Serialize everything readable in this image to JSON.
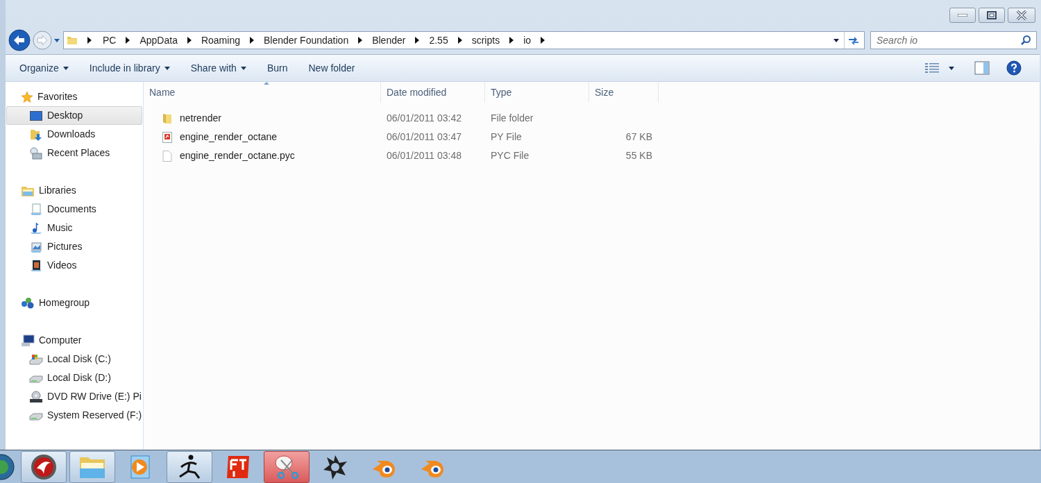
{
  "address": {
    "crumbs": [
      "PC",
      "AppData",
      "Roaming",
      "Blender Foundation",
      "Blender",
      "2.55",
      "scripts",
      "io"
    ]
  },
  "search": {
    "placeholder": "Search io"
  },
  "toolbar": {
    "items": [
      {
        "label": "Organize",
        "dropdown": true
      },
      {
        "label": "Include in library",
        "dropdown": true
      },
      {
        "label": "Share with",
        "dropdown": true
      },
      {
        "label": "Burn",
        "dropdown": false
      },
      {
        "label": "New folder",
        "dropdown": false
      }
    ]
  },
  "sidebar": {
    "groups": [
      {
        "label": "Favorites",
        "children": [
          {
            "label": "Desktop",
            "selected": true
          },
          {
            "label": "Downloads",
            "selected": false
          },
          {
            "label": "Recent Places",
            "selected": false
          }
        ]
      },
      {
        "label": "Libraries",
        "children": [
          {
            "label": "Documents",
            "selected": false
          },
          {
            "label": "Music",
            "selected": false
          },
          {
            "label": "Pictures",
            "selected": false
          },
          {
            "label": "Videos",
            "selected": false
          }
        ]
      },
      {
        "label": "Homegroup"
      },
      {
        "label": "Computer",
        "children": [
          {
            "label": "Local Disk (C:)",
            "selected": false
          },
          {
            "label": "Local Disk (D:)",
            "selected": false
          },
          {
            "label": "DVD RW Drive (E:) Pi",
            "selected": false
          },
          {
            "label": "System Reserved (F:)",
            "selected": false
          }
        ]
      }
    ]
  },
  "table": {
    "columns": [
      "Name",
      "Date modified",
      "Type",
      "Size"
    ],
    "rows": [
      {
        "kind": "folder",
        "name": "netrender",
        "date": "06/01/2011 03:42",
        "type": "File folder",
        "size": ""
      },
      {
        "kind": "py",
        "name": "engine_render_octane",
        "date": "06/01/2011 03:47",
        "type": "PY File",
        "size": "67 KB"
      },
      {
        "kind": "file",
        "name": "engine_render_octane.pyc",
        "date": "06/01/2011 03:48",
        "type": "PYC File",
        "size": "55 KB"
      }
    ]
  },
  "taskbar": {
    "apps": [
      {
        "running": true,
        "alert": false
      },
      {
        "running": true,
        "alert": false
      },
      {
        "running": false,
        "alert": false
      },
      {
        "running": true,
        "alert": false
      },
      {
        "running": false,
        "alert": false
      },
      {
        "running": true,
        "alert": true
      },
      {
        "running": false,
        "alert": false
      },
      {
        "running": false,
        "alert": false
      },
      {
        "running": false,
        "alert": false
      }
    ]
  }
}
